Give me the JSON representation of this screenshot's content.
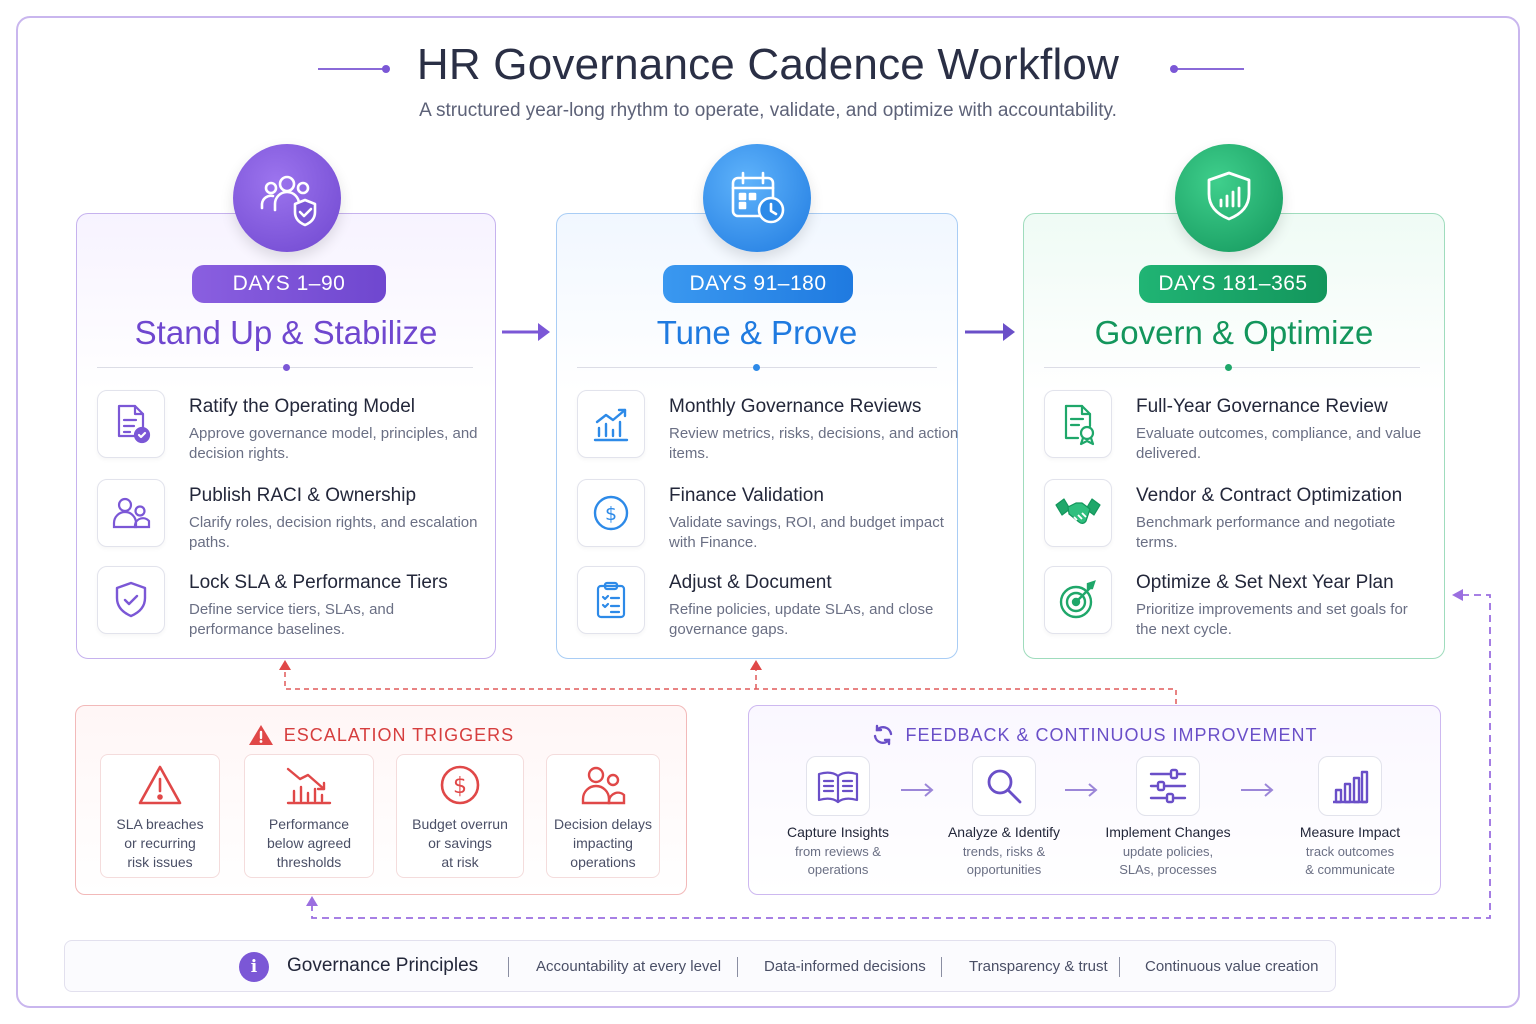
{
  "title": "HR Governance Cadence Workflow",
  "subtitle": "A structured year-long rhythm to operate, validate, and optimize with accountability.",
  "colors": {
    "purple": "#7b57d6",
    "blue": "#2d8ae8",
    "green": "#1fa76a",
    "red": "#e04848",
    "violet_dashed": "#9b6fe0"
  },
  "phases": [
    {
      "days": "DAYS 1–90",
      "title": "Stand Up & Stabilize",
      "icon": "users-shield-icon",
      "items": [
        {
          "title": "Ratify the Operating Model",
          "desc": "Approve governance model, principles, and decision rights.",
          "icon": "document-check-icon"
        },
        {
          "title": "Publish RACI & Ownership",
          "desc": "Clarify roles, decision rights, and escalation paths.",
          "icon": "people-icon"
        },
        {
          "title": "Lock SLA & Performance Tiers",
          "desc": "Define service tiers, SLAs, and performance baselines.",
          "icon": "shield-check-icon"
        }
      ]
    },
    {
      "days": "DAYS 91–180",
      "title": "Tune & Prove",
      "icon": "calendar-clock-icon",
      "items": [
        {
          "title": "Monthly Governance Reviews",
          "desc": "Review metrics, risks, decisions, and action items.",
          "icon": "chart-trend-icon"
        },
        {
          "title": "Finance Validation",
          "desc": "Validate savings, ROI, and budget impact with Finance.",
          "icon": "dollar-circle-icon"
        },
        {
          "title": "Adjust & Document",
          "desc": "Refine policies, update SLAs, and close governance gaps.",
          "icon": "clipboard-checklist-icon"
        }
      ]
    },
    {
      "days": "DAYS 181–365",
      "title": "Govern & Optimize",
      "icon": "shield-chart-icon",
      "items": [
        {
          "title": "Full-Year Governance Review",
          "desc": "Evaluate outcomes, compliance, and value delivered.",
          "icon": "document-award-icon"
        },
        {
          "title": "Vendor & Contract Optimization",
          "desc": "Benchmark performance and negotiate terms.",
          "icon": "handshake-icon"
        },
        {
          "title": "Optimize & Set Next Year Plan",
          "desc": "Prioritize improvements and set goals for the next cycle.",
          "icon": "target-icon"
        }
      ]
    }
  ],
  "escalation": {
    "title": "ESCALATION TRIGGERS",
    "icon": "warning-icon",
    "triggers": [
      {
        "text_lines": [
          "SLA breaches",
          "or recurring",
          "risk issues"
        ],
        "icon": "warning-icon"
      },
      {
        "text_lines": [
          "Performance",
          "below agreed",
          "thresholds"
        ],
        "icon": "chart-decline-icon"
      },
      {
        "text_lines": [
          "Budget overrun",
          "or savings",
          "at risk"
        ],
        "icon": "dollar-circle-icon"
      },
      {
        "text_lines": [
          "Decision delays",
          "impacting",
          "operations"
        ],
        "icon": "people-icon"
      }
    ]
  },
  "feedback": {
    "title": "FEEDBACK  &  CONTINUOUS  IMPROVEMENT",
    "icon": "refresh-icon",
    "steps": [
      {
        "title": "Capture Insights",
        "desc_lines": [
          "from reviews &",
          "operations"
        ],
        "icon": "open-book-icon"
      },
      {
        "title": "Analyze & Identify",
        "desc_lines": [
          "trends, risks &",
          "opportunities"
        ],
        "icon": "magnifier-icon"
      },
      {
        "title": "Implement Changes",
        "desc_lines": [
          "update policies,",
          "SLAs, processes"
        ],
        "icon": "sliders-icon"
      },
      {
        "title": "Measure Impact",
        "desc_lines": [
          "track outcomes",
          "& communicate"
        ],
        "icon": "bar-chart-icon"
      }
    ]
  },
  "principles": {
    "label": "Governance Principles",
    "icon": "info-icon",
    "items": [
      "Accountability at every level",
      "Data-informed decisions",
      "Transparency & trust",
      "Continuous value creation"
    ]
  }
}
